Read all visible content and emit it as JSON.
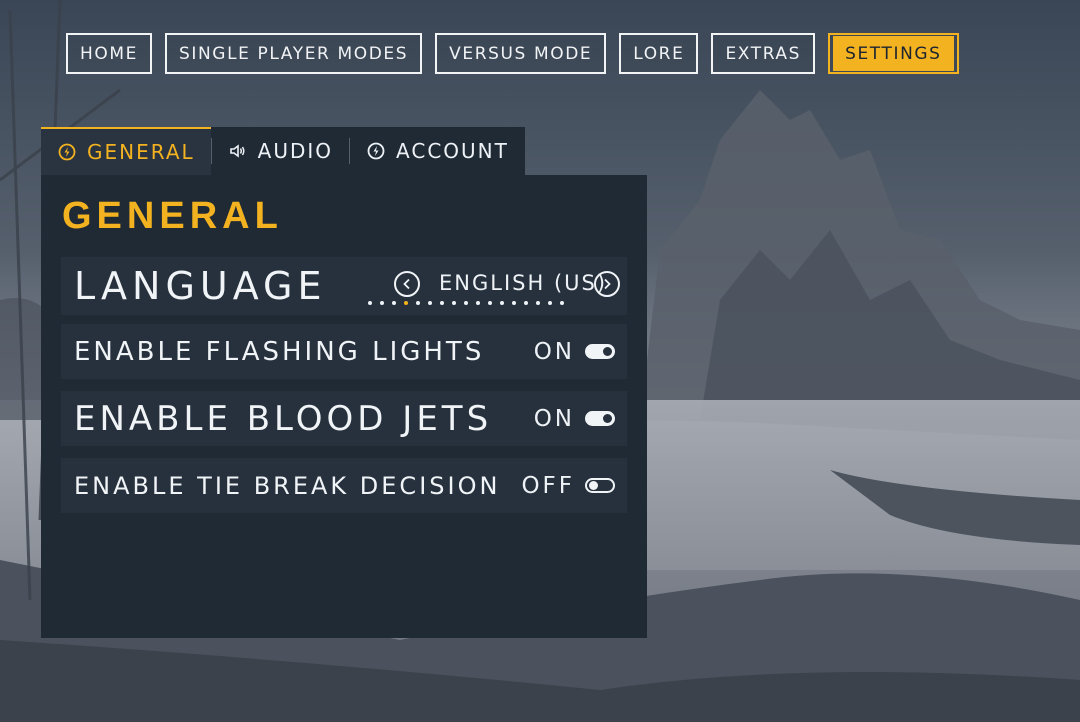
{
  "nav": {
    "items": [
      {
        "label": "HOME"
      },
      {
        "label": "SINGLE PLAYER MODES"
      },
      {
        "label": "VERSUS MODE"
      },
      {
        "label": "LORE"
      },
      {
        "label": "EXTRAS"
      },
      {
        "label": "SETTINGS",
        "active": true
      }
    ]
  },
  "tabs": [
    {
      "label": "GENERAL",
      "icon": "bolt-circle-icon",
      "active": true
    },
    {
      "label": "AUDIO",
      "icon": "speaker-icon"
    },
    {
      "label": "ACCOUNT",
      "icon": "bolt-circle-icon"
    }
  ],
  "panel": {
    "title": "GENERAL",
    "language": {
      "label": "LANGUAGE",
      "value": "ENGLISH (US)",
      "option_count": 17,
      "selected_index": 3
    },
    "flashing_lights": {
      "label": "ENABLE FLASHING LIGHTS",
      "state": "ON"
    },
    "blood_jets": {
      "label": "ENABLE BLOOD JETS",
      "state": "ON"
    },
    "tie_break": {
      "label": "ENABLE TIE BREAK DECISION",
      "state": "OFF"
    }
  },
  "colors": {
    "accent": "#f3b21f",
    "panel": "#1f2a35",
    "row": "#26313d",
    "text": "#eef2f6"
  }
}
